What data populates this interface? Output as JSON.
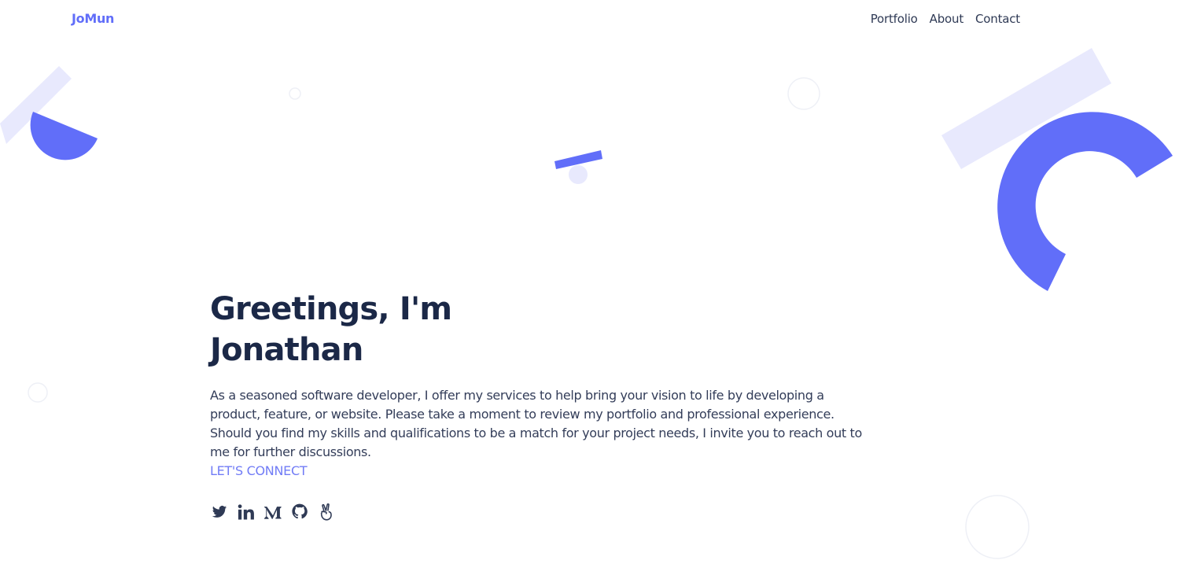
{
  "header": {
    "logo": "JoMun",
    "nav": [
      {
        "label": "Portfolio"
      },
      {
        "label": "About"
      },
      {
        "label": "Contact"
      }
    ]
  },
  "hero": {
    "title_line1": "Greetings, I'm",
    "title_line2": "Jonathan",
    "description": "As a seasoned software developer, I offer my services to help bring your vision to life by developing a product, feature, or website. Please take a moment to review my portfolio and professional experience. Should you find my skills and qualifications to be a match for your project needs, I invite you to reach out to me for further discussions.",
    "cta_label": "LET'S CONNECT"
  },
  "socials": [
    {
      "icon": "twitter-icon"
    },
    {
      "icon": "linkedin-icon"
    },
    {
      "icon": "medium-icon"
    },
    {
      "icon": "github-icon"
    },
    {
      "icon": "angellist-icon"
    }
  ],
  "colors": {
    "accent": "#616ef9",
    "accent_light": "#e8e9fd",
    "heading": "#1b2847",
    "body_text": "#333d59",
    "cta": "#717cf6",
    "background": "#ffffff"
  }
}
